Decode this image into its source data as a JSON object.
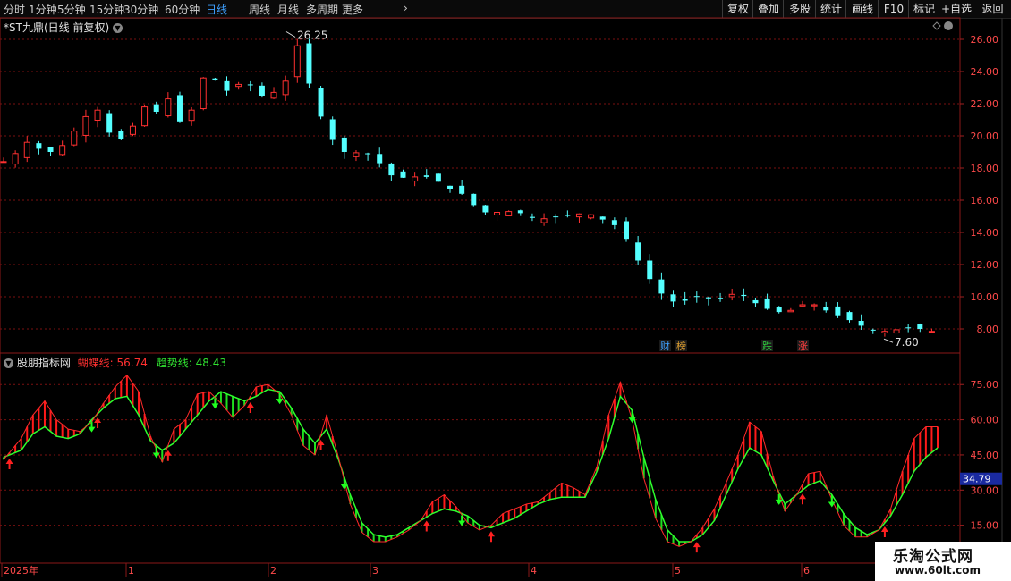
{
  "toolbar": {
    "period_tabs": [
      "分时",
      "1分钟",
      "5分钟",
      "15分钟",
      "30分钟",
      "60分钟",
      "日线",
      "周线",
      "月线",
      "多周期",
      "更多"
    ],
    "active_tab": "日线",
    "more_arrow": "›",
    "right_buttons": [
      "复权",
      "叠加",
      "多股",
      "统计",
      "画线",
      "F10",
      "标记",
      "+自选",
      "返回"
    ]
  },
  "main_chart": {
    "title": "*ST九鼎(日线 前复权)",
    "y_ticks": [
      "26.00",
      "24.00",
      "22.00",
      "20.00",
      "18.00",
      "16.00",
      "14.00",
      "12.00",
      "10.00",
      "8.00"
    ],
    "high_label": "26.25",
    "low_label": "7.60",
    "event_tags": [
      {
        "text": "财",
        "color": "#3ea0ff"
      },
      {
        "text": "榜",
        "color": "#e0a030"
      },
      {
        "text": "跌",
        "color": "#30d040"
      },
      {
        "text": "涨",
        "color": "#ff4040"
      }
    ]
  },
  "indicator": {
    "title": "股朋指标网",
    "line1_label": "蝴蝶线:",
    "line1_value": "56.74",
    "line2_label": "趋势线:",
    "line2_value": "48.43",
    "y_ticks": [
      "75.00",
      "60.00",
      "45.00",
      "30.00",
      "15.00"
    ],
    "current_marker": "34.79"
  },
  "x_axis": {
    "labels": [
      "2025年",
      "1",
      "2",
      "3",
      "4",
      "5",
      "6"
    ]
  },
  "watermark": {
    "line1": "乐淘公式网",
    "line2": "www.60lt.com"
  },
  "colors": {
    "up": "#ff3030",
    "down": "#54ffff",
    "butterfly_up": "#ff1a1a",
    "butterfly_down": "#1fe01f",
    "grid": "#7a1010",
    "active_tab": "#3ea0ff"
  },
  "chart_data": [
    {
      "type": "candlestick",
      "title": "*ST九鼎(日线 前复权)",
      "ylim": [
        7.0,
        27.0
      ],
      "x": [
        "2025年",
        "1",
        "2",
        "3",
        "4",
        "5",
        "6"
      ],
      "close_path": [
        [
          0,
          18.4
        ],
        [
          4,
          18.9
        ],
        [
          8,
          19.6
        ],
        [
          12,
          19.2
        ],
        [
          16,
          19.0
        ],
        [
          20,
          19.4
        ],
        [
          24,
          20.3
        ],
        [
          28,
          21.2
        ],
        [
          32,
          21.6
        ],
        [
          36,
          20.2
        ],
        [
          40,
          19.8
        ],
        [
          44,
          20.6
        ],
        [
          48,
          21.8
        ],
        [
          52,
          21.5
        ],
        [
          56,
          22.3
        ],
        [
          60,
          20.9
        ],
        [
          64,
          21.6
        ],
        [
          66,
          23.4
        ],
        [
          70,
          23.8
        ],
        [
          74,
          23.1
        ],
        [
          78,
          22.5
        ],
        [
          82,
          23.9
        ],
        [
          86,
          22.4
        ],
        [
          90,
          22.6
        ],
        [
          94,
          22.8
        ],
        [
          98,
          24.0
        ],
        [
          100,
          25.6
        ],
        [
          102,
          24.5
        ],
        [
          106,
          22.0
        ],
        [
          110,
          20.4
        ],
        [
          114,
          19.1
        ],
        [
          118,
          18.9
        ],
        [
          122,
          19.0
        ],
        [
          126,
          18.8
        ],
        [
          130,
          17.8
        ],
        [
          134,
          17.3
        ],
        [
          138,
          17.5
        ],
        [
          142,
          17.4
        ],
        [
          146,
          17.5
        ],
        [
          150,
          16.8
        ],
        [
          154,
          16.6
        ],
        [
          158,
          16.2
        ],
        [
          162,
          15.2
        ],
        [
          166,
          15.3
        ],
        [
          170,
          15.2
        ],
        [
          174,
          15.4
        ],
        [
          178,
          15.0
        ],
        [
          182,
          14.8
        ],
        [
          186,
          14.9
        ],
        [
          190,
          15.0
        ],
        [
          194,
          15.1
        ],
        [
          198,
          15.2
        ],
        [
          202,
          15.0
        ],
        [
          206,
          14.6
        ],
        [
          210,
          14.3
        ],
        [
          214,
          12.9
        ],
        [
          218,
          11.6
        ],
        [
          222,
          10.6
        ],
        [
          226,
          9.8
        ],
        [
          230,
          9.6
        ],
        [
          234,
          9.9
        ],
        [
          238,
          10.1
        ],
        [
          242,
          9.7
        ],
        [
          246,
          10.0
        ],
        [
          250,
          10.3
        ],
        [
          254,
          9.8
        ],
        [
          258,
          9.4
        ],
        [
          262,
          9.1
        ],
        [
          266,
          9.0
        ],
        [
          270,
          9.3
        ],
        [
          274,
          9.7
        ],
        [
          278,
          9.3
        ],
        [
          282,
          9.0
        ],
        [
          286,
          8.7
        ],
        [
          290,
          8.4
        ],
        [
          294,
          8.0
        ],
        [
          298,
          7.8
        ],
        [
          302,
          7.9
        ],
        [
          306,
          8.0
        ],
        [
          310,
          8.1
        ],
        [
          314,
          7.9
        ],
        [
          318,
          7.8
        ]
      ],
      "max_high": 26.25,
      "min_low": 7.6
    },
    {
      "type": "line",
      "title": "股朋指标网",
      "ylim": [
        0,
        85
      ],
      "series": [
        {
          "name": "蝴蝶线",
          "last": 56.74
        },
        {
          "name": "趋势线",
          "last": 48.43
        }
      ],
      "butterfly_path": [
        [
          0,
          43
        ],
        [
          6,
          52
        ],
        [
          10,
          62
        ],
        [
          14,
          68
        ],
        [
          18,
          60
        ],
        [
          22,
          56
        ],
        [
          26,
          55
        ],
        [
          30,
          59
        ],
        [
          34,
          67
        ],
        [
          38,
          74
        ],
        [
          42,
          79
        ],
        [
          46,
          72
        ],
        [
          50,
          53
        ],
        [
          54,
          42
        ],
        [
          58,
          56
        ],
        [
          62,
          60
        ],
        [
          66,
          71
        ],
        [
          70,
          72
        ],
        [
          74,
          67
        ],
        [
          78,
          61
        ],
        [
          82,
          66
        ],
        [
          86,
          74
        ],
        [
          90,
          75
        ],
        [
          94,
          71
        ],
        [
          98,
          62
        ],
        [
          102,
          49
        ],
        [
          106,
          45
        ],
        [
          110,
          62
        ],
        [
          114,
          44
        ],
        [
          118,
          24
        ],
        [
          122,
          12
        ],
        [
          126,
          8
        ],
        [
          130,
          8
        ],
        [
          134,
          10
        ],
        [
          138,
          13
        ],
        [
          142,
          17
        ],
        [
          146,
          25
        ],
        [
          150,
          28
        ],
        [
          154,
          23
        ],
        [
          158,
          16
        ],
        [
          162,
          13
        ],
        [
          166,
          15
        ],
        [
          170,
          20
        ],
        [
          174,
          22
        ],
        [
          178,
          24
        ],
        [
          182,
          25
        ],
        [
          186,
          29
        ],
        [
          190,
          33
        ],
        [
          194,
          31
        ],
        [
          198,
          28
        ],
        [
          202,
          40
        ],
        [
          206,
          62
        ],
        [
          210,
          76
        ],
        [
          214,
          60
        ],
        [
          218,
          35
        ],
        [
          222,
          18
        ],
        [
          226,
          8
        ],
        [
          230,
          6
        ],
        [
          234,
          8
        ],
        [
          238,
          14
        ],
        [
          242,
          22
        ],
        [
          246,
          33
        ],
        [
          250,
          45
        ],
        [
          254,
          59
        ],
        [
          258,
          55
        ],
        [
          262,
          36
        ],
        [
          266,
          21
        ],
        [
          270,
          28
        ],
        [
          274,
          37
        ],
        [
          278,
          38
        ],
        [
          282,
          26
        ],
        [
          286,
          15
        ],
        [
          290,
          10
        ],
        [
          294,
          10
        ],
        [
          298,
          13
        ],
        [
          302,
          22
        ],
        [
          306,
          38
        ],
        [
          310,
          52
        ],
        [
          314,
          57
        ],
        [
          318,
          57
        ]
      ],
      "trend_path": [
        [
          0,
          44
        ],
        [
          6,
          47
        ],
        [
          10,
          54
        ],
        [
          14,
          57
        ],
        [
          18,
          53
        ],
        [
          22,
          52
        ],
        [
          26,
          54
        ],
        [
          30,
          60
        ],
        [
          34,
          65
        ],
        [
          38,
          69
        ],
        [
          42,
          70
        ],
        [
          46,
          62
        ],
        [
          50,
          51
        ],
        [
          54,
          47
        ],
        [
          58,
          50
        ],
        [
          62,
          56
        ],
        [
          66,
          62
        ],
        [
          70,
          68
        ],
        [
          74,
          72
        ],
        [
          78,
          70
        ],
        [
          82,
          68
        ],
        [
          86,
          70
        ],
        [
          90,
          73
        ],
        [
          94,
          72
        ],
        [
          98,
          65
        ],
        [
          102,
          56
        ],
        [
          106,
          50
        ],
        [
          110,
          56
        ],
        [
          114,
          43
        ],
        [
          118,
          28
        ],
        [
          122,
          16
        ],
        [
          126,
          11
        ],
        [
          130,
          10
        ],
        [
          134,
          11
        ],
        [
          138,
          14
        ],
        [
          142,
          17
        ],
        [
          146,
          20
        ],
        [
          150,
          22
        ],
        [
          154,
          21
        ],
        [
          158,
          19
        ],
        [
          162,
          15
        ],
        [
          166,
          14
        ],
        [
          170,
          16
        ],
        [
          174,
          18
        ],
        [
          178,
          21
        ],
        [
          182,
          24
        ],
        [
          186,
          26
        ],
        [
          190,
          27
        ],
        [
          194,
          27
        ],
        [
          198,
          27
        ],
        [
          202,
          38
        ],
        [
          206,
          52
        ],
        [
          210,
          70
        ],
        [
          214,
          64
        ],
        [
          218,
          44
        ],
        [
          222,
          26
        ],
        [
          226,
          13
        ],
        [
          230,
          8
        ],
        [
          234,
          8
        ],
        [
          238,
          11
        ],
        [
          242,
          17
        ],
        [
          246,
          28
        ],
        [
          250,
          39
        ],
        [
          254,
          48
        ],
        [
          258,
          45
        ],
        [
          262,
          34
        ],
        [
          266,
          24
        ],
        [
          270,
          28
        ],
        [
          274,
          32
        ],
        [
          278,
          34
        ],
        [
          282,
          28
        ],
        [
          286,
          20
        ],
        [
          290,
          14
        ],
        [
          294,
          11
        ],
        [
          298,
          13
        ],
        [
          302,
          19
        ],
        [
          306,
          28
        ],
        [
          310,
          38
        ],
        [
          314,
          44
        ],
        [
          318,
          48
        ]
      ]
    }
  ]
}
